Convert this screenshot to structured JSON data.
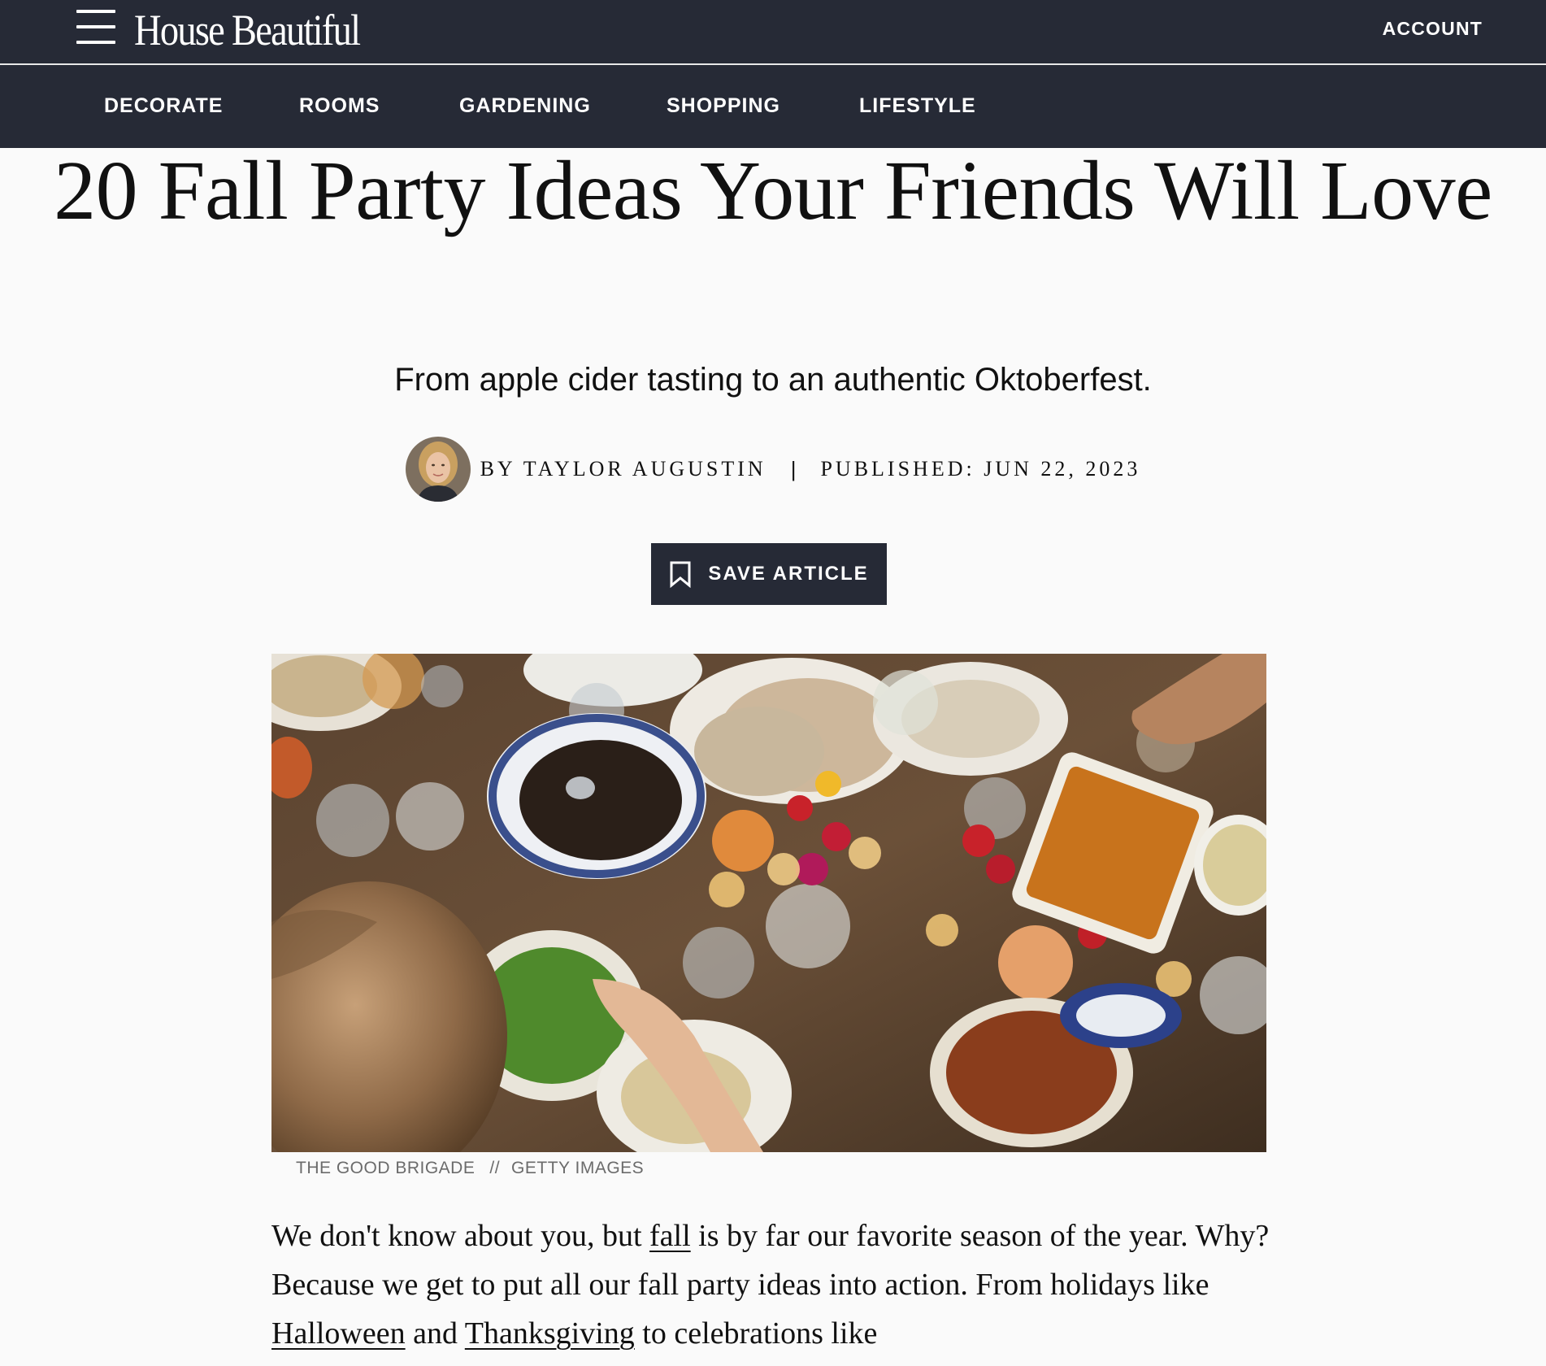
{
  "header": {
    "logo": "House Beautiful",
    "account_label": "ACCOUNT"
  },
  "nav": {
    "items": [
      {
        "label": "DECORATE"
      },
      {
        "label": "ROOMS"
      },
      {
        "label": "GARDENING"
      },
      {
        "label": "SHOPPING"
      },
      {
        "label": "LIFESTYLE"
      }
    ]
  },
  "article": {
    "title": "20 Fall Party Ideas Your Friends Will Love",
    "dek": "From apple cider tasting to an authentic Oktoberfest.",
    "byline": "BY TAYLOR AUGUSTIN",
    "byline_separator": "|",
    "published": "PUBLISHED: JUN 22, 2023",
    "save_label": "SAVE ARTICLE",
    "image_credit_source": "THE GOOD BRIGADE",
    "image_credit_separator": "//",
    "image_credit_agency": "GETTY IMAGES",
    "body": {
      "p1_a": "We don't know about you, but ",
      "p1_link_fall": "fall",
      "p1_b": " is by far our favorite season of the year. Why? Because we get to put all our fall party ideas into action. From holidays like ",
      "p1_link_halloween": "Halloween",
      "p1_c": " and ",
      "p1_link_thanksgiving": "Thanksgiving",
      "p1_d": " to celebrations like"
    }
  },
  "colors": {
    "header_bg": "#262a36",
    "page_bg": "#fafafa",
    "text": "#111111",
    "credit_text": "#6b6b6b"
  },
  "icons": {
    "menu": "hamburger-menu-icon",
    "save": "bookmark-icon"
  }
}
